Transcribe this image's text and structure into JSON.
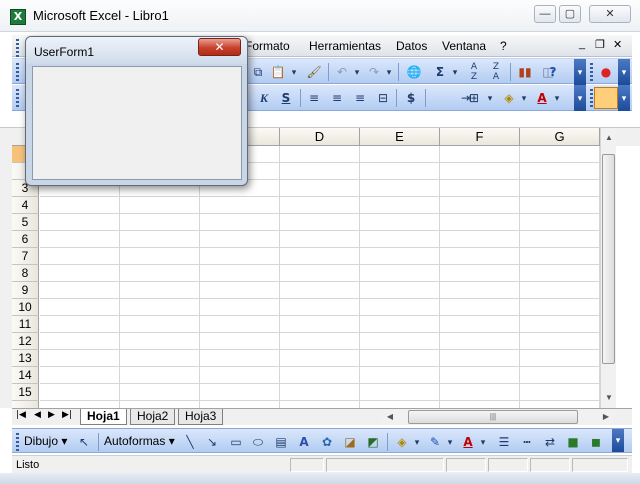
{
  "window": {
    "title": "Microsoft Excel - Libro1",
    "icon": "excel-icon",
    "minimize": "—",
    "maximize": "▢",
    "close": "✕"
  },
  "menu": {
    "items": [
      "Formato",
      "Herramientas",
      "Datos",
      "Ventana",
      "?"
    ],
    "mdi_minimize": "_",
    "mdi_restore": "❐",
    "mdi_close": "✕"
  },
  "toolbar_standard": {
    "icons": [
      "paste-icon",
      "format-painter-icon",
      "undo-icon",
      "redo-icon",
      "hyperlink-icon",
      "autosum-icon",
      "sort-asc-icon",
      "sort-desc-icon",
      "chart-wizard-icon",
      "help-icon"
    ],
    "autosum_glyph": "Σ"
  },
  "toolbar_format": {
    "italic": "K",
    "underline": "S",
    "currency": "$"
  },
  "columns": [
    "D",
    "E",
    "F",
    "G"
  ],
  "rows": [
    "3",
    "4",
    "5",
    "6",
    "7",
    "8",
    "9",
    "10",
    "11",
    "12",
    "13",
    "14",
    "15"
  ],
  "sheets": {
    "tabs": [
      "Hoja1",
      "Hoja2",
      "Hoja3"
    ],
    "active": "Hoja1",
    "nav": [
      "|◀",
      "◀",
      "▶",
      "▶|"
    ]
  },
  "drawing": {
    "dibujo": "Dibujo",
    "autoformas": "Autoformas"
  },
  "status": {
    "text": "Listo"
  },
  "userform": {
    "title": "UserForm1",
    "close": "✕"
  },
  "colors": {
    "toolbar": "#b2ccf2",
    "close_red": "#c7412c",
    "selected_row": "#f7c37a"
  }
}
